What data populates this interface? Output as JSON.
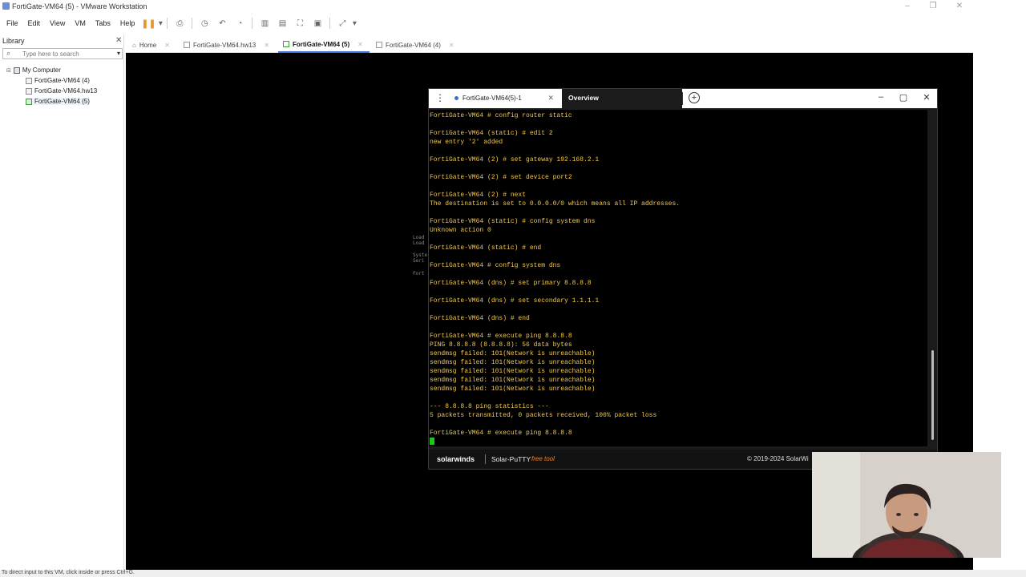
{
  "window": {
    "title": "FortiGate-VM64 (5) - VMware Workstation"
  },
  "menubar": {
    "items": [
      "File",
      "Edit",
      "View",
      "VM",
      "Tabs",
      "Help"
    ]
  },
  "library": {
    "title": "Library",
    "search_placeholder": "Type here to search",
    "tree": {
      "root": "My Computer",
      "items": [
        "FortiGate-VM64 (4)",
        "FortiGate-VM64.hw13",
        "FortiGate-VM64 (5)"
      ]
    }
  },
  "tabs": [
    {
      "label": "Home"
    },
    {
      "label": "FortiGate-VM64.hw13"
    },
    {
      "label": "FortiGate-VM64 (5)"
    },
    {
      "label": "FortiGate-VM64 (4)"
    }
  ],
  "boot_text": [
    "Load",
    "Load",
    "Syste",
    "Seri",
    "Fort"
  ],
  "putty": {
    "tab_label": "FortiGate-VM64(5)-1",
    "overview_label": "Overview",
    "terminal_lines": [
      "FortiGate-VM64 # config router static",
      "",
      "FortiGate-VM64 (static) # edit 2",
      "new entry '2' added",
      "",
      "FortiGate-VM64 (2) # set gateway 192.168.2.1",
      "",
      "FortiGate-VM64 (2) # set device port2",
      "",
      "FortiGate-VM64 (2) # next",
      "The destination is set to 0.0.0.0/0 which means all IP addresses.",
      "",
      "FortiGate-VM64 (static) # config system dns",
      "Unknown action 0",
      "",
      "FortiGate-VM64 (static) # end",
      "",
      "FortiGate-VM64 # config system dns",
      "",
      "FortiGate-VM64 (dns) # set primary 8.8.8.8",
      "",
      "FortiGate-VM64 (dns) # set secondary 1.1.1.1",
      "",
      "FortiGate-VM64 (dns) # end",
      "",
      "FortiGate-VM64 # execute ping 8.8.8.8",
      "PING 8.8.8.8 (8.8.8.8): 56 data bytes",
      "sendmsg failed: 101(Network is unreachable)",
      "sendmsg failed: 101(Network is unreachable)",
      "sendmsg failed: 101(Network is unreachable)",
      "sendmsg failed: 101(Network is unreachable)",
      "sendmsg failed: 101(Network is unreachable)",
      "",
      "--- 8.8.8.8 ping statistics ---",
      "5 packets transmitted, 0 packets received, 100% packet loss",
      "",
      "FortiGate-VM64 # execute ping 8.8.8.8"
    ],
    "footer": {
      "brand": "solarwinds",
      "product": "Solar-PuTTY",
      "free_tag": "free tool",
      "copyright": "© 2019-2024 SolarWi"
    }
  },
  "statusbar": {
    "text": "To direct input to this VM, click inside or press Ctrl+G."
  }
}
